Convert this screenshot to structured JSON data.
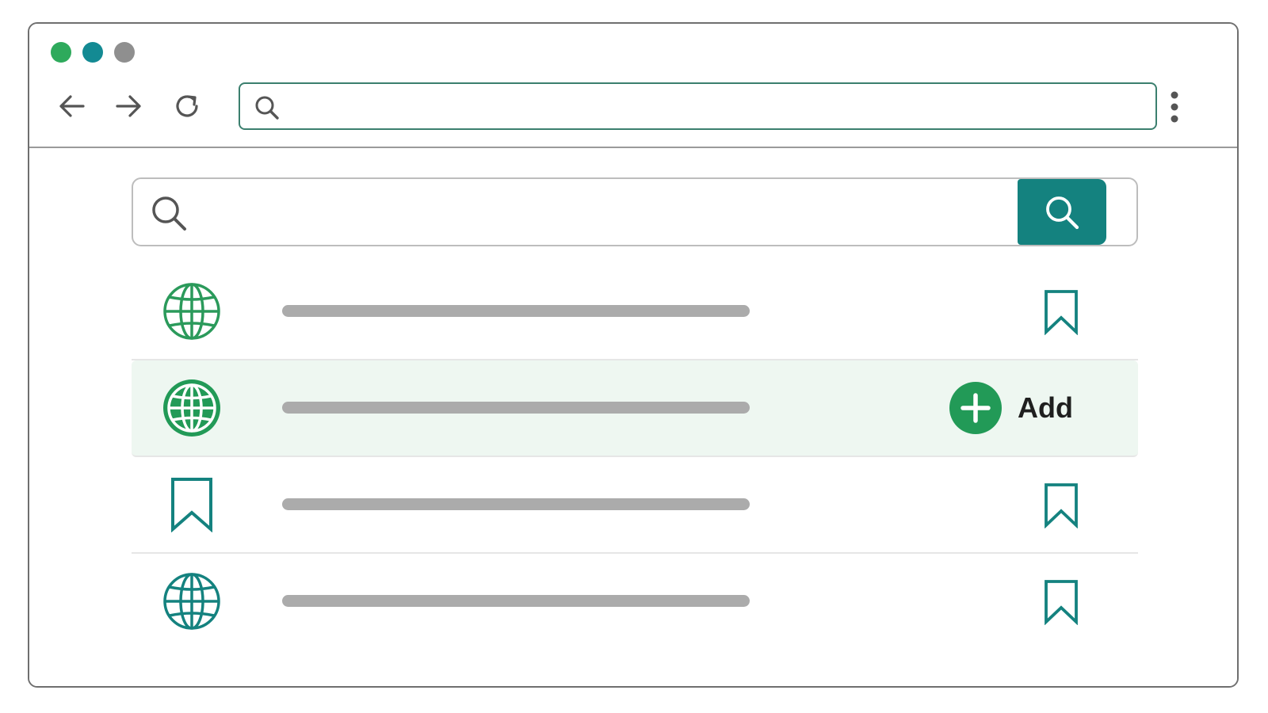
{
  "colors": {
    "dot_green": "#2eaa5c",
    "dot_teal": "#138a93",
    "dot_gray": "#8f8f8f",
    "accent_teal": "#14827f",
    "accent_green": "#229a57",
    "highlight_row_bg": "#eef7f1",
    "placeholder_line": "#ababab"
  },
  "browser": {
    "window_controls": [
      "dot-green",
      "dot-teal",
      "dot-gray"
    ],
    "nav_buttons": [
      "back-arrow-icon",
      "forward-arrow-icon",
      "reload-icon"
    ],
    "address_bar": {
      "value": "",
      "placeholder": ""
    },
    "menu_icon": "vertical-dots-icon"
  },
  "search": {
    "value": "",
    "placeholder": "",
    "button_icon": "search-icon"
  },
  "results": [
    {
      "lead_icon": "globe-icon",
      "lead_style": "outline-green",
      "action": "bookmark-icon",
      "highlighted": false
    },
    {
      "lead_icon": "globe-icon",
      "lead_style": "filled-green",
      "action": "add",
      "highlighted": true
    },
    {
      "lead_icon": "bookmark-icon",
      "lead_style": "outline-teal",
      "action": "bookmark-icon",
      "highlighted": false
    },
    {
      "lead_icon": "globe-icon",
      "lead_style": "outline-teal",
      "action": "bookmark-icon",
      "highlighted": false
    }
  ],
  "add_button": {
    "label": "Add",
    "icon": "plus-icon"
  }
}
